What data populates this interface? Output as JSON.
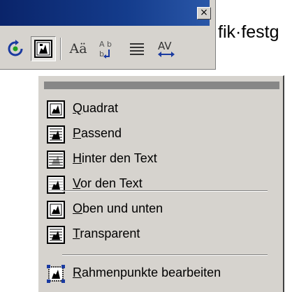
{
  "toolbar": {
    "close_glyph": "×",
    "buttons": [
      {
        "name": "rotate-icon"
      },
      {
        "name": "text-wrap-icon"
      },
      {
        "name": "text-case-icon",
        "text": "Aä"
      },
      {
        "name": "vertical-text-icon",
        "text": "A b"
      },
      {
        "name": "align-icon",
        "text": "≡"
      },
      {
        "name": "char-spacing-icon",
        "text": "AV"
      }
    ]
  },
  "document": {
    "text": "fik·festg"
  },
  "menu": {
    "items": [
      {
        "pre": "",
        "u": "Q",
        "post": "uadrat",
        "icon": "wrap-square-icon"
      },
      {
        "pre": "",
        "u": "P",
        "post": "assend",
        "icon": "wrap-tight-icon"
      },
      {
        "pre": "",
        "u": "H",
        "post": "inter den Text",
        "icon": "wrap-behind-icon"
      },
      {
        "pre": "",
        "u": "V",
        "post": "or den Text",
        "icon": "wrap-front-icon"
      },
      {
        "pre": "",
        "u": "O",
        "post": "ben und unten",
        "icon": "wrap-top-bottom-icon"
      },
      {
        "pre": "",
        "u": "T",
        "post": "ransparent",
        "icon": "wrap-through-icon"
      },
      {
        "pre": "",
        "u": "R",
        "post": "ahmenpunkte bearbeiten",
        "icon": "edit-wrap-points-icon"
      }
    ]
  }
}
